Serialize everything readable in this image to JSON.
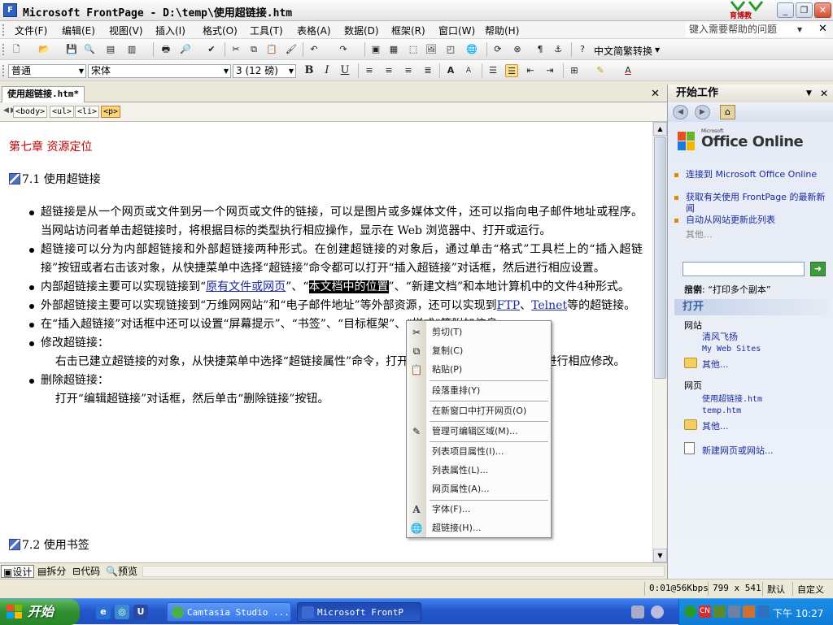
{
  "window": {
    "title": "Microsoft FrontPage - D:\\temp\\使用超链接.htm",
    "logo_text": "育博教",
    "controls": [
      "_",
      "❐",
      "✕"
    ]
  },
  "menubar": {
    "items": [
      "文件(F)",
      "编辑(E)",
      "视图(V)",
      "插入(I)",
      "格式(O)",
      "工具(T)",
      "表格(A)",
      "数据(D)",
      "框架(R)",
      "窗口(W)",
      "帮助(H)"
    ],
    "help_placeholder": "键入需要帮助的问题"
  },
  "toolbar1": {
    "convert_label": "中文简繁转换"
  },
  "toolbar2": {
    "style": "普通",
    "font": "宋体",
    "size": "3 (12 磅)",
    "bold": "B",
    "italic": "I",
    "underline": "U"
  },
  "document": {
    "tab_label": "使用超链接.htm*",
    "tags": [
      "<body>",
      "<ul>",
      "<li>",
      "<p>"
    ],
    "chapter_title": "第七章 资源定位",
    "section1": "7.1 使用超链接",
    "section2": "7.2 使用书签",
    "bullets": [
      {
        "type": "bullet",
        "text": "超链接是从一个网页或文件到另一个网页或文件的链接，可以是图片或多媒体文件，还可以指向电子邮件地址或程序。当网站访问者单击超链接时，将根据目标的类型执行相应操作，显示在 Web 浏览器中、打开或运行。"
      },
      {
        "type": "bullet",
        "text": "超链接可以分为内部超链接和外部超链接两种形式。在创建超链接的对象后，通过单击“格式”工具栏上的“插入超链接”按钮或者右击该对象，从快捷菜单中选择“超链接”命令都可以打开“插入超链接”对话框，然后进行相应设置。"
      },
      {
        "type": "bullet_links",
        "pre": "内部超链接主要可以实现链接到“",
        "link": "原有文件或网页",
        "mid": "”、“",
        "highlight": "本文档中的位置",
        "post": "”、“新建文档”和本地计算机中的文件4种形式。"
      },
      {
        "type": "bullet_links2",
        "pre": "外部超链接主要可以实现链接到“万维网网站”和“电子邮件地址”等外部资源，还可以实现到",
        "link": "FTP",
        "mid": "、",
        "link2": "Telnet",
        "post": "等的超链接。"
      },
      {
        "type": "bullet",
        "text": "在“插入超链接”对话框中还可以设置“屏幕提示”、“书签”、“目标框架”、“样式”等附加信息。"
      },
      {
        "type": "bullet",
        "text": "修改超链接："
      },
      {
        "type": "para",
        "text": "    右击已建立超链接的对象，从快捷菜单中选择“超链接属性”命令，打开“编辑超链接”对话框，然后进行相应修改。"
      },
      {
        "type": "bullet",
        "text": "删除超链接："
      },
      {
        "type": "para",
        "text": "    打开“编辑超链接”对话框，然后单击“删除链接”按钮。"
      }
    ]
  },
  "context_menu": {
    "items": [
      {
        "label": "剪切(T)",
        "icon": "scissors-icon",
        "glyph": "✂"
      },
      {
        "label": "复制(C)",
        "icon": "copy-icon",
        "glyph": "⧉"
      },
      {
        "label": "粘贴(P)",
        "icon": "paste-icon",
        "glyph": "📋"
      },
      {
        "label": "段落重排(Y)",
        "icon": "",
        "glyph": ""
      },
      {
        "label": "在新窗口中打开网页(O)",
        "icon": "",
        "glyph": ""
      },
      {
        "label": "管理可编辑区域(M)...",
        "icon": "edit-region-icon",
        "glyph": "✎"
      },
      {
        "label": "列表项目属性(I)...",
        "icon": "",
        "glyph": ""
      },
      {
        "label": "列表属性(L)...",
        "icon": "",
        "glyph": ""
      },
      {
        "label": "网页属性(A)...",
        "icon": "",
        "glyph": ""
      },
      {
        "label": "字体(F)...",
        "icon": "font-icon",
        "glyph": "A"
      },
      {
        "label": "超链接(H)...",
        "icon": "hyperlink-icon",
        "glyph": "🌐"
      }
    ]
  },
  "views": {
    "design": "设计",
    "split": "拆分",
    "code": "代码",
    "preview": "预览"
  },
  "status": {
    "speed": "0:01@56Kbps",
    "dimensions": "799 x 541",
    "mode1": "默认",
    "mode2": "自定义"
  },
  "taskpane": {
    "title": "开始工作",
    "office_small": "Microsoft",
    "office_large": "Office Online",
    "online_links": [
      "连接到 Microsoft Office Online",
      "获取有关使用 FrontPage 的最新新闻",
      "自动从网站更新此列表"
    ],
    "more": "其他...",
    "search_label": "搜索",
    "search_example": "示例: “打印多个副本”",
    "open_title": "打开",
    "website_label": "网站",
    "websites": [
      "清风飞扬",
      "My Web Sites"
    ],
    "pages_label": "网页",
    "pages": [
      "使用超链接.htm",
      "temp.htm"
    ],
    "new_page": "新建网页或网站..."
  },
  "taskbar": {
    "start": "开始",
    "tasks": [
      {
        "label": "Camtasia Studio ...",
        "active": false
      },
      {
        "label": "Microsoft FrontP",
        "active": true
      }
    ],
    "clock": "下午 10:27"
  }
}
